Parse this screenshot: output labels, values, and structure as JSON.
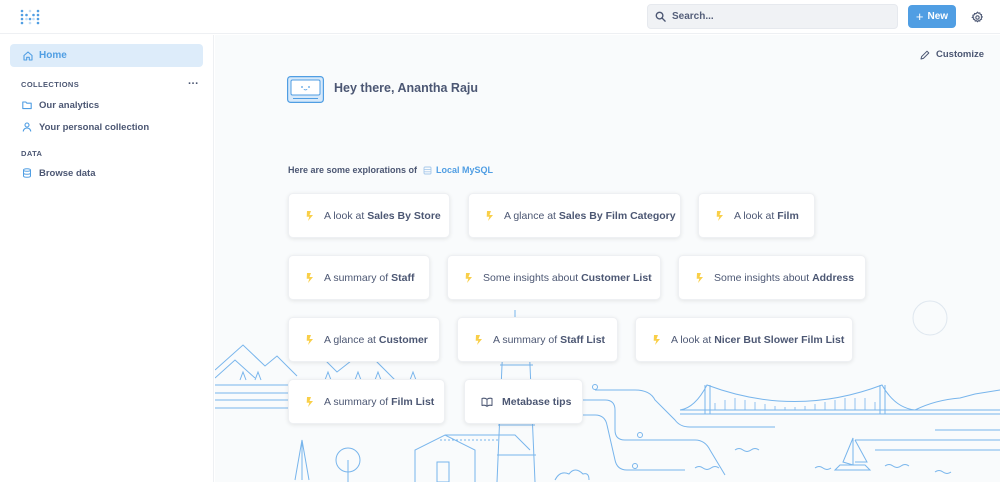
{
  "topbar": {
    "search_placeholder": "Search...",
    "new_label": "New"
  },
  "sidebar": {
    "home_label": "Home",
    "collections_title": "COLLECTIONS",
    "collections_menu": "...",
    "collections": [
      {
        "label": "Our analytics",
        "icon": "folder-icon"
      },
      {
        "label": "Your personal collection",
        "icon": "person-icon"
      }
    ],
    "data_title": "DATA",
    "browse_label": "Browse data"
  },
  "main": {
    "customize_label": "Customize",
    "greeting": "Hey there, Anantha Raju",
    "explore_prefix": "Here are some explorations of",
    "database_name": "Local MySQL",
    "cards": [
      {
        "prefix": "A look at ",
        "entity": "Sales By Store"
      },
      {
        "prefix": "A glance at ",
        "entity": "Sales By Film Category"
      },
      {
        "prefix": "A look at ",
        "entity": "Film"
      },
      {
        "prefix": "A summary of ",
        "entity": "Staff"
      },
      {
        "prefix": "Some insights about ",
        "entity": "Customer List"
      },
      {
        "prefix": "Some insights about ",
        "entity": "Address"
      },
      {
        "prefix": "A glance at ",
        "entity": "Customer"
      },
      {
        "prefix": "A summary of ",
        "entity": "Staff List"
      },
      {
        "prefix": "A look at ",
        "entity": "Nicer But Slower Film List"
      },
      {
        "prefix": "A summary of ",
        "entity": "Film List"
      }
    ],
    "tips_label": "Metabase tips"
  },
  "colors": {
    "brand": "#509ee3",
    "text": "#4c5773",
    "bolt": "#f9cf48",
    "home_highlight": "#ddecfa"
  }
}
